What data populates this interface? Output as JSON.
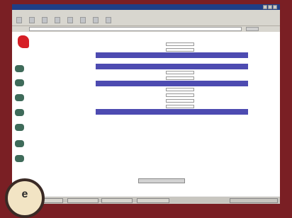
{
  "badge": {
    "letter": "e"
  },
  "window": {
    "title": "",
    "menu": [
      "",
      "",
      "",
      "",
      "",
      ""
    ]
  },
  "nav": {
    "items": [
      {
        "label": ""
      },
      {
        "label": ""
      },
      {
        "label": ""
      },
      {
        "label": ""
      },
      {
        "label": ""
      },
      {
        "label": ""
      },
      {
        "label": ""
      }
    ]
  },
  "form": {
    "sections": [
      "",
      "",
      "",
      ""
    ],
    "rows": [
      {
        "label": ""
      },
      {
        "label": ""
      },
      {
        "label": ""
      },
      {
        "label": ""
      },
      {
        "label": ""
      },
      {
        "label": ""
      },
      {
        "label": ""
      },
      {
        "label": ""
      },
      {
        "label": ""
      },
      {
        "label": ""
      },
      {
        "label": ""
      },
      {
        "label": ""
      },
      {
        "label": ""
      },
      {
        "label": ""
      },
      {
        "label": ""
      },
      {
        "label": ""
      },
      {
        "label": ""
      }
    ],
    "submit_label": ""
  },
  "taskbar": {
    "tasks": [
      "",
      "",
      "",
      ""
    ],
    "tray": ""
  },
  "colors": {
    "frame": "#7a1f24",
    "section_header": "#4d4bb1",
    "title_bar": "#1f3e86",
    "logo": "#d61f26"
  }
}
